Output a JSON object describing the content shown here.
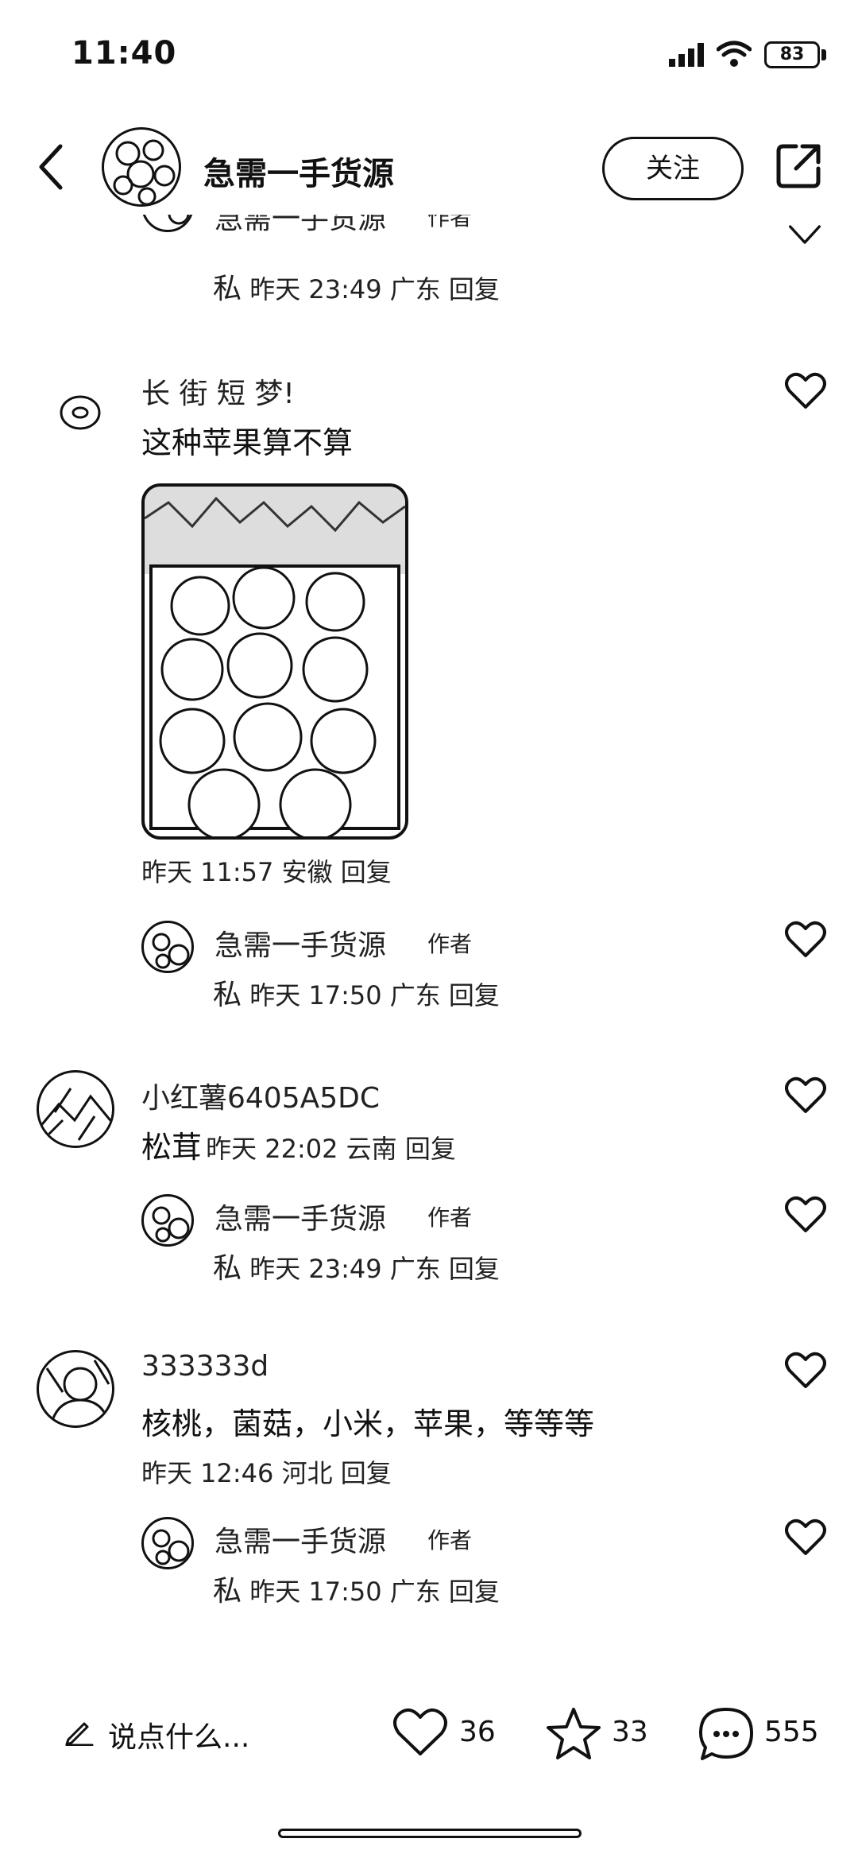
{
  "status_bar": {
    "time": "11:40",
    "battery": "83"
  },
  "header": {
    "title": "急需一手货源",
    "follow_label": "关注"
  },
  "comments": [
    {
      "partial_name": "急需一手货源",
      "tag": "作者",
      "prefix": "私",
      "meta": "昨天 23:49 广东 回复"
    },
    {
      "name": "长 街 短 梦!",
      "text": "这种苹果算不算",
      "meta": "昨天 11:57 安徽 回复"
    },
    {
      "name": "急需一手货源",
      "tag": "作者",
      "prefix": "私",
      "meta": "昨天 17:50 广东 回复"
    },
    {
      "name": "小红薯6405A5DC",
      "prefix": "松茸",
      "meta": "昨天 22:02 云南 回复"
    },
    {
      "name": "急需一手货源",
      "tag": "作者",
      "prefix": "私",
      "meta": "昨天 23:49 广东 回复"
    },
    {
      "name": "333333d",
      "text": "核桃，菌菇，小米，苹果，等等等",
      "meta": "昨天 12:46 河北 回复"
    },
    {
      "name": "急需一手货源",
      "tag": "作者",
      "prefix": "私",
      "meta": "昨天 17:50 广东 回复"
    }
  ],
  "bottom_bar": {
    "input_placeholder": "说点什么...",
    "likes": "36",
    "stars": "33",
    "comments": "555"
  }
}
